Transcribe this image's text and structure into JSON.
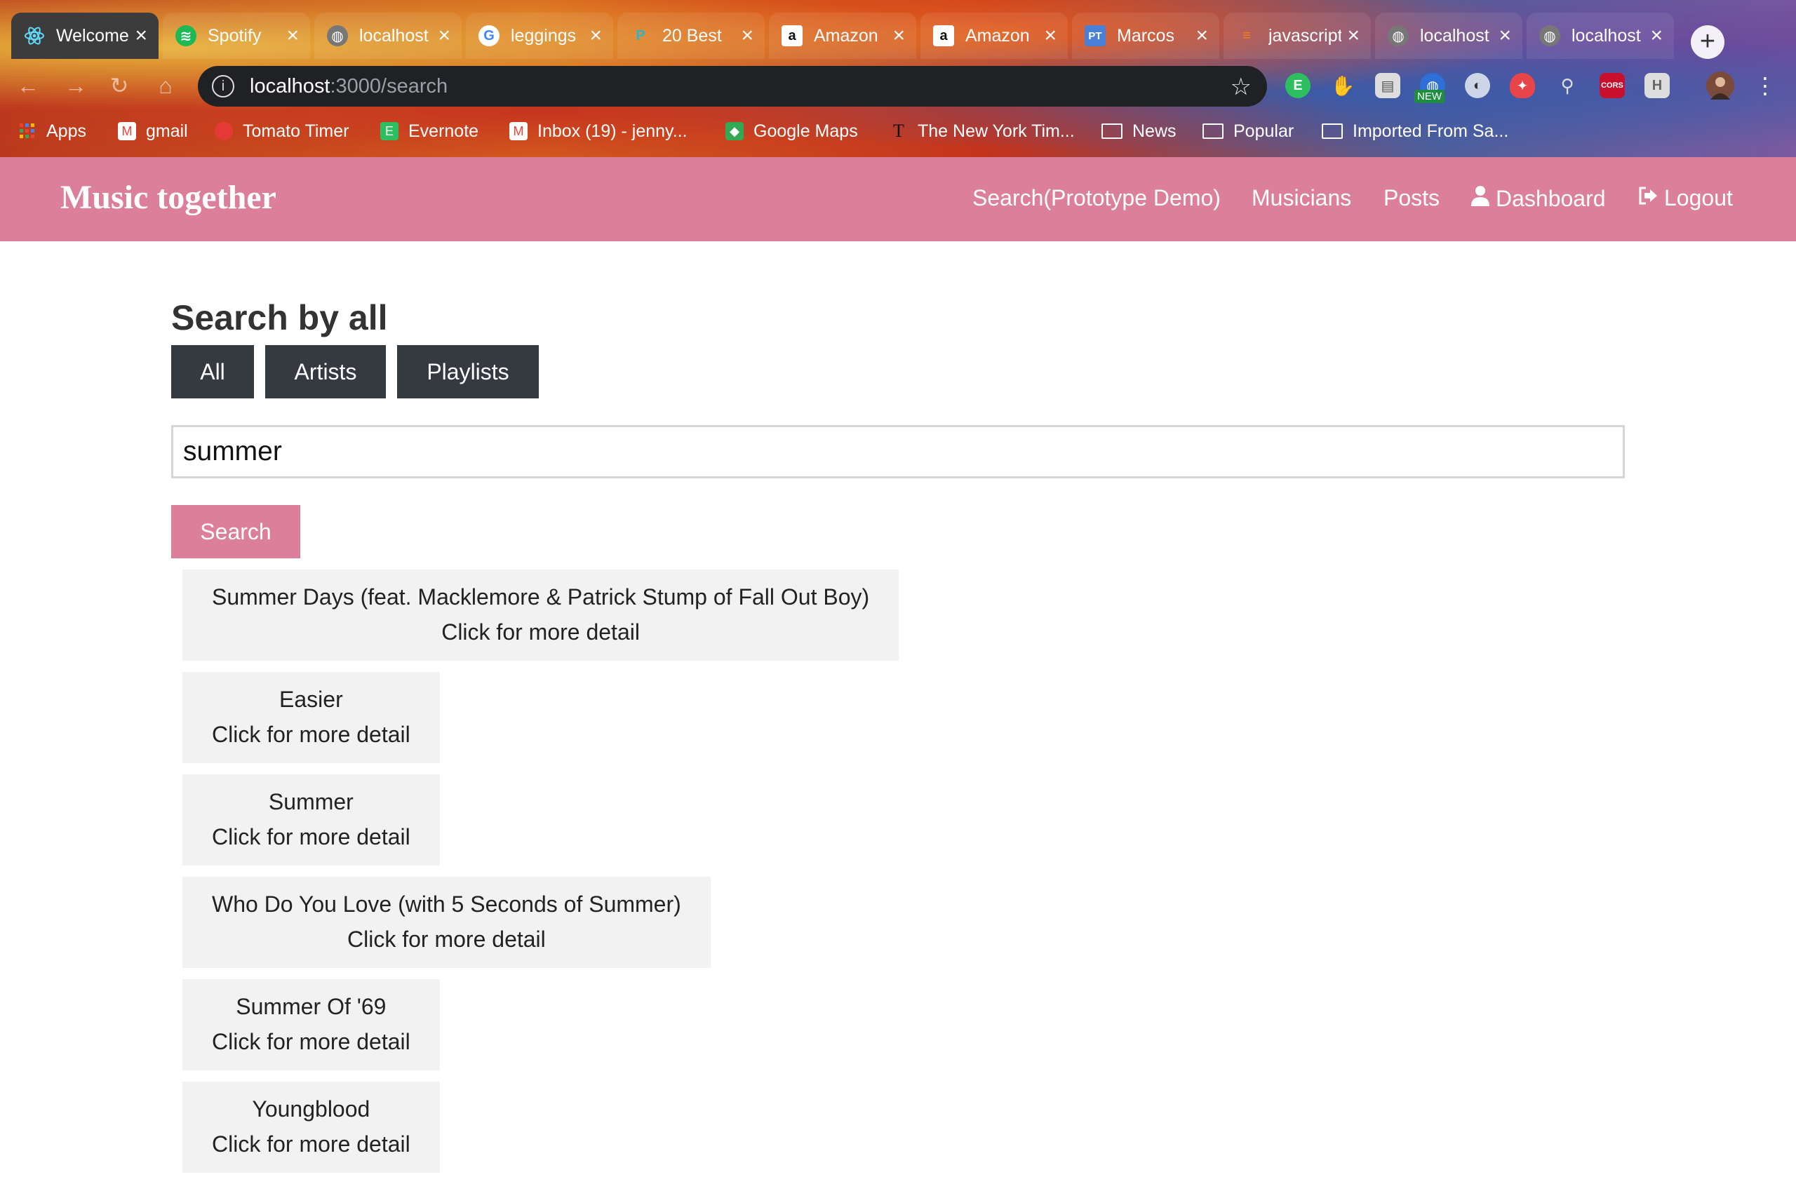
{
  "browser": {
    "tabs": [
      {
        "title": "Welcome",
        "icon": "react-icon",
        "active": true
      },
      {
        "title": "Spotify",
        "icon": "spotify-icon"
      },
      {
        "title": "localhost",
        "icon": "globe-icon"
      },
      {
        "title": "leggings",
        "icon": "google-icon"
      },
      {
        "title": "20 Best",
        "icon": "p-icon"
      },
      {
        "title": "Amazon",
        "icon": "amazon-icon"
      },
      {
        "title": "Amazon",
        "icon": "amazon-icon"
      },
      {
        "title": "Marcos",
        "icon": "pt-icon"
      },
      {
        "title": "javascript",
        "icon": "stack-icon"
      },
      {
        "title": "localhost",
        "icon": "globe-icon"
      },
      {
        "title": "localhost",
        "icon": "globe-icon"
      }
    ],
    "address": {
      "host": "localhost",
      "path": ":3000/search"
    },
    "extension_badge": "NEW",
    "cors_label": "CORS",
    "bookmarks": [
      {
        "label": "Apps",
        "icon": "apps-grid-icon"
      },
      {
        "label": "gmail",
        "icon": "gmail-icon"
      },
      {
        "label": "Tomato Timer",
        "icon": "tomato-icon"
      },
      {
        "label": "Evernote",
        "icon": "evernote-icon"
      },
      {
        "label": "Inbox (19) - jenny...",
        "icon": "gmail-icon"
      },
      {
        "label": "Google Maps",
        "icon": "maps-icon"
      },
      {
        "label": "The New York Tim...",
        "icon": "nyt-icon"
      },
      {
        "label": "News",
        "icon": "folder-icon"
      },
      {
        "label": "Popular",
        "icon": "folder-icon"
      },
      {
        "label": "Imported From Sa...",
        "icon": "folder-icon"
      }
    ]
  },
  "site": {
    "brand": "Music together",
    "nav": {
      "search": "Search(Prototype Demo)",
      "musicians": "Musicians",
      "posts": "Posts",
      "dashboard": "Dashboard",
      "logout": "Logout"
    },
    "colors": {
      "primary": "#db7f9b",
      "dark_button": "#343a40",
      "result_bg": "#f2f2f2"
    }
  },
  "search": {
    "heading": "Search by all",
    "filters": [
      "All",
      "Artists",
      "Playlists"
    ],
    "query": "summer",
    "button": "Search",
    "detail_label": "Click for more detail",
    "results": [
      "Summer Days (feat. Macklemore & Patrick Stump of Fall Out Boy)",
      "Easier",
      "Summer",
      "Who Do You Love (with 5 Seconds of Summer)",
      "Summer Of '69",
      "Youngblood"
    ]
  }
}
